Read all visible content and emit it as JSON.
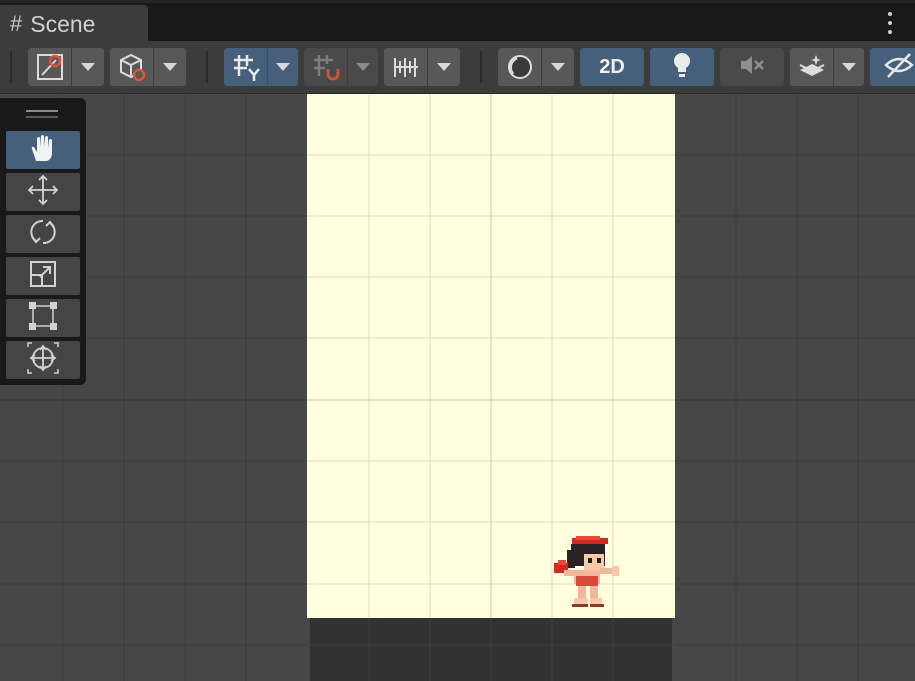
{
  "window": {
    "tab_title": "Scene",
    "tab_icon": "#"
  },
  "toolbar": {
    "toggle_2d_label": "2D",
    "icons": [
      "draw-mode-icon",
      "gizmo-cube-icon",
      "grid-snap-icon",
      "increment-snap-icon",
      "ruler-icon",
      "shading-sphere-icon",
      "lighting-bulb-icon",
      "audio-mute-icon",
      "effects-icon",
      "scene-visibility-icon"
    ],
    "active_toggles": [
      "grid-snap",
      "2D",
      "lighting"
    ]
  },
  "tools": {
    "items": [
      "hand-tool",
      "move-tool",
      "rotate-tool",
      "scale-tool",
      "rect-tool",
      "transform-tool"
    ],
    "active": "hand-tool"
  },
  "scene": {
    "camera_bg": "#ffffde",
    "viewport_bg": "#474747",
    "ground_color": "#323232",
    "character": "red-helmet-warrior-sprite"
  },
  "colors": {
    "accent": "#46607c",
    "button": "#585858"
  }
}
